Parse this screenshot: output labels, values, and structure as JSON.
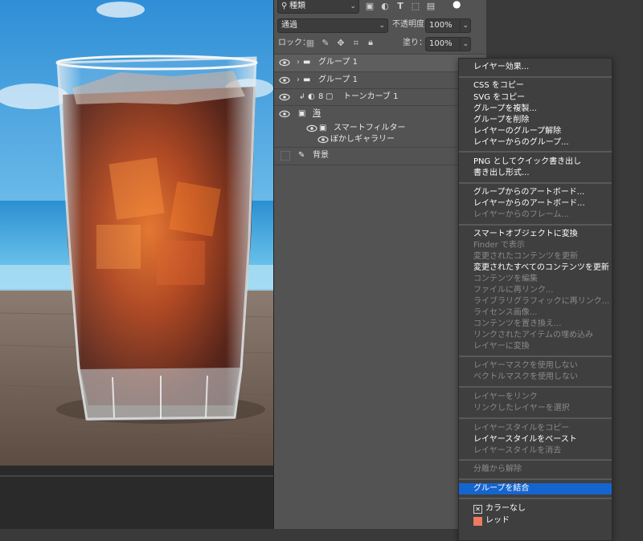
{
  "panel": {
    "filter_label": "種類",
    "blend_mode": "通過",
    "opacity_label": "不透明度：",
    "opacity_value": "100%",
    "lock_label": "ロック：",
    "fill_label": "塗り：",
    "fill_value": "100%"
  },
  "layers": [
    {
      "name": "グループ 1",
      "kind": "group",
      "selected": true
    },
    {
      "name": "グループ 1",
      "kind": "group",
      "selected": false
    },
    {
      "name": "トーンカーブ 1",
      "kind": "adjustment",
      "selected": false
    },
    {
      "name": "海",
      "kind": "smart-object",
      "selected": false
    },
    {
      "name": "スマートフィルター",
      "kind": "smart-filter",
      "selected": false
    },
    {
      "name": "ぼかしギャラリー",
      "kind": "filter",
      "selected": false
    },
    {
      "name": "背景",
      "kind": "background",
      "selected": false
    }
  ],
  "menu": {
    "items": [
      {
        "label": "レイヤー効果...",
        "disabled": false
      },
      {
        "label": "CSS をコピー",
        "disabled": false
      },
      {
        "label": "SVG をコピー",
        "disabled": false
      },
      {
        "label": "グループを複製...",
        "disabled": false
      },
      {
        "label": "グループを削除",
        "disabled": false
      },
      {
        "label": "レイヤーのグループ解除",
        "disabled": false
      },
      {
        "label": "レイヤーからのグループ...",
        "disabled": false
      },
      {
        "label": "PNG としてクイック書き出し",
        "disabled": false
      },
      {
        "label": "書き出し形式...",
        "disabled": false
      },
      {
        "label": "グループからのアートボード...",
        "disabled": false
      },
      {
        "label": "レイヤーからのアートボード...",
        "disabled": false
      },
      {
        "label": "レイヤーからのフレーム...",
        "disabled": true
      },
      {
        "label": "スマートオブジェクトに変換",
        "disabled": false
      },
      {
        "label": "Finder で表示",
        "disabled": true
      },
      {
        "label": "変更されたコンテンツを更新",
        "disabled": true
      },
      {
        "label": "変更されたすべてのコンテンツを更新",
        "disabled": false
      },
      {
        "label": "コンテンツを編集",
        "disabled": true
      },
      {
        "label": "ファイルに再リンク...",
        "disabled": true
      },
      {
        "label": "ライブラリグラフィックに再リンク...",
        "disabled": true
      },
      {
        "label": "ライセンス画像...",
        "disabled": true
      },
      {
        "label": "コンテンツを置き換え...",
        "disabled": true
      },
      {
        "label": "リンクされたアイテムの埋め込み",
        "disabled": true
      },
      {
        "label": "レイヤーに変換",
        "disabled": true
      },
      {
        "label": "レイヤーマスクを使用しない",
        "disabled": true
      },
      {
        "label": "ベクトルマスクを使用しない",
        "disabled": true
      },
      {
        "label": "レイヤーをリンク",
        "disabled": true
      },
      {
        "label": "リンクしたレイヤーを選択",
        "disabled": true
      },
      {
        "label": "レイヤースタイルをコピー",
        "disabled": true
      },
      {
        "label": "レイヤースタイルをペースト",
        "disabled": false
      },
      {
        "label": "レイヤースタイルを消去",
        "disabled": true
      },
      {
        "label": "分離から解除",
        "disabled": true
      },
      {
        "label": "グループを結合",
        "disabled": false,
        "highlighted": true
      },
      {
        "label": "カラーなし",
        "disabled": false
      },
      {
        "label": "レッド",
        "disabled": false
      }
    ]
  },
  "colors": {
    "highlight": "#1565d0",
    "red_swatch": "#f07a60"
  }
}
